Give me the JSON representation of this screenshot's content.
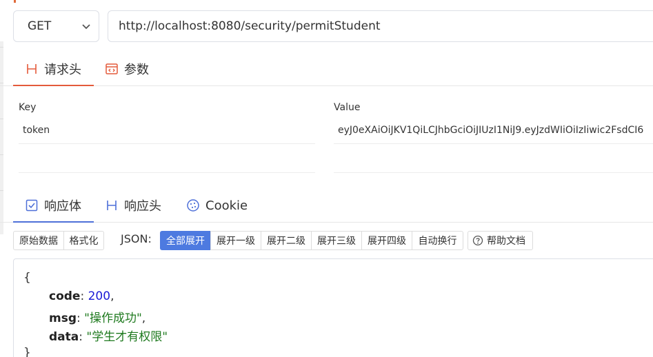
{
  "request": {
    "method": "GET",
    "url": "http://localhost:8080/security/permitStudent"
  },
  "request_tabs": [
    {
      "label": "请求头",
      "icon": "header-h-icon",
      "active": true
    },
    {
      "label": "参数",
      "icon": "params-code-icon",
      "active": false
    }
  ],
  "headers_table": {
    "key_header": "Key",
    "value_header": "Value",
    "rows": [
      {
        "key": "token",
        "value": "eyJ0eXAiOiJKV1QiLCJhbGciOiJIUzI1NiJ9.eyJzdWIiOiIzIiwic2FsdCI6"
      }
    ]
  },
  "response_tabs": [
    {
      "label": "响应体",
      "icon": "checkbox-icon",
      "active": true
    },
    {
      "label": "响应头",
      "icon": "header-h-icon",
      "active": false
    },
    {
      "label": "Cookie",
      "icon": "cookie-icon",
      "active": false
    }
  ],
  "toolbar": {
    "raw_label": "原始数据",
    "format_label": "格式化",
    "json_label": "JSON:",
    "expand_all": "全部展开",
    "expand_1": "展开一级",
    "expand_2": "展开二级",
    "expand_3": "展开三级",
    "expand_4": "展开四级",
    "wrap": "自动换行",
    "help": "帮助文档"
  },
  "response_json": {
    "open_brace": "{",
    "close_brace": "}",
    "code_key": "code",
    "code_value": "200",
    "msg_key": "msg",
    "msg_value": "\"操作成功\"",
    "data_key": "data",
    "data_value": "\"学生才有权限\""
  },
  "colors": {
    "request_accent": "#e45a3a",
    "response_accent": "#4d6fd8",
    "primary_button": "#4d7ae0",
    "json_number": "#1a1ad6",
    "json_string": "#1f7a1f"
  }
}
